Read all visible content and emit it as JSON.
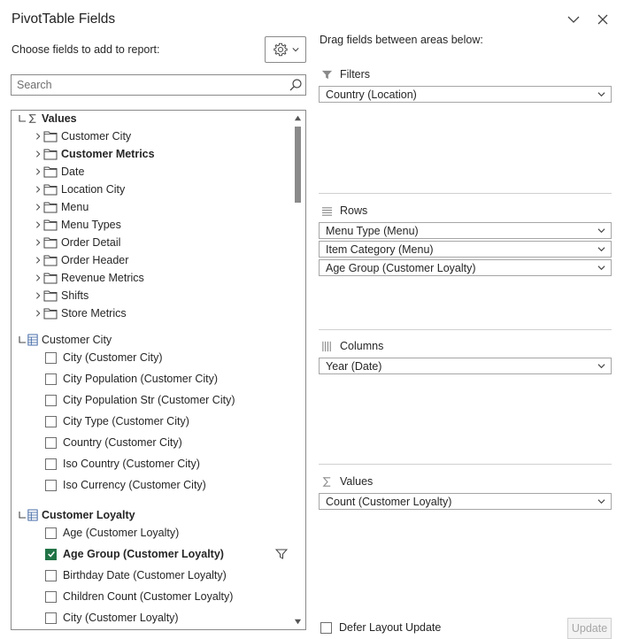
{
  "panel": {
    "title": "PivotTable Fields",
    "choose_label": "Choose fields to add to report:",
    "drag_label": "Drag fields between areas below:",
    "search_placeholder": "Search"
  },
  "field_tree": {
    "values_group": {
      "label": "Values",
      "folders": [
        "Customer City",
        "Customer Metrics",
        "Date",
        "Location City",
        "Menu",
        "Menu Types",
        "Order Detail",
        "Order Header",
        "Revenue Metrics",
        "Shifts",
        "Store Metrics"
      ],
      "bold_folder": "Customer Metrics"
    },
    "tables": [
      {
        "label": "Customer City",
        "bold": false,
        "fields": [
          {
            "label": "City (Customer City)",
            "checked": false
          },
          {
            "label": "City Population (Customer City)",
            "checked": false
          },
          {
            "label": "City Population Str (Customer City)",
            "checked": false
          },
          {
            "label": "City Type (Customer City)",
            "checked": false
          },
          {
            "label": "Country (Customer City)",
            "checked": false
          },
          {
            "label": "Iso Country (Customer City)",
            "checked": false
          },
          {
            "label": "Iso Currency (Customer City)",
            "checked": false
          }
        ]
      },
      {
        "label": "Customer Loyalty",
        "bold": true,
        "fields": [
          {
            "label": "Age (Customer Loyalty)",
            "checked": false
          },
          {
            "label": "Age Group (Customer Loyalty)",
            "checked": true,
            "filtered": true
          },
          {
            "label": "Birthday Date (Customer Loyalty)",
            "checked": false
          },
          {
            "label": "Children Count (Customer Loyalty)",
            "checked": false
          },
          {
            "label": "City (Customer Loyalty)",
            "checked": false
          }
        ]
      }
    ]
  },
  "areas": {
    "filters": {
      "label": "Filters",
      "items": [
        "Country (Location)"
      ]
    },
    "rows": {
      "label": "Rows",
      "items": [
        "Menu Type (Menu)",
        "Item Category (Menu)",
        "Age Group (Customer Loyalty)"
      ]
    },
    "columns": {
      "label": "Columns",
      "items": [
        "Year (Date)"
      ]
    },
    "values": {
      "label": "Values",
      "items": [
        "Count (Customer Loyalty)"
      ]
    }
  },
  "footer": {
    "defer_label": "Defer Layout Update",
    "defer_checked": false,
    "update_label": "Update"
  },
  "colors": {
    "check_green": "#217346",
    "border": "#8a8a8a",
    "text": "#262626"
  },
  "icons": {
    "close": "close-icon",
    "collapse": "chevron-down-icon",
    "gear": "gear-icon",
    "search": "search-icon",
    "folder": "folder-icon",
    "table": "table-icon",
    "sigma": "sigma-icon",
    "filter": "filter-icon"
  }
}
